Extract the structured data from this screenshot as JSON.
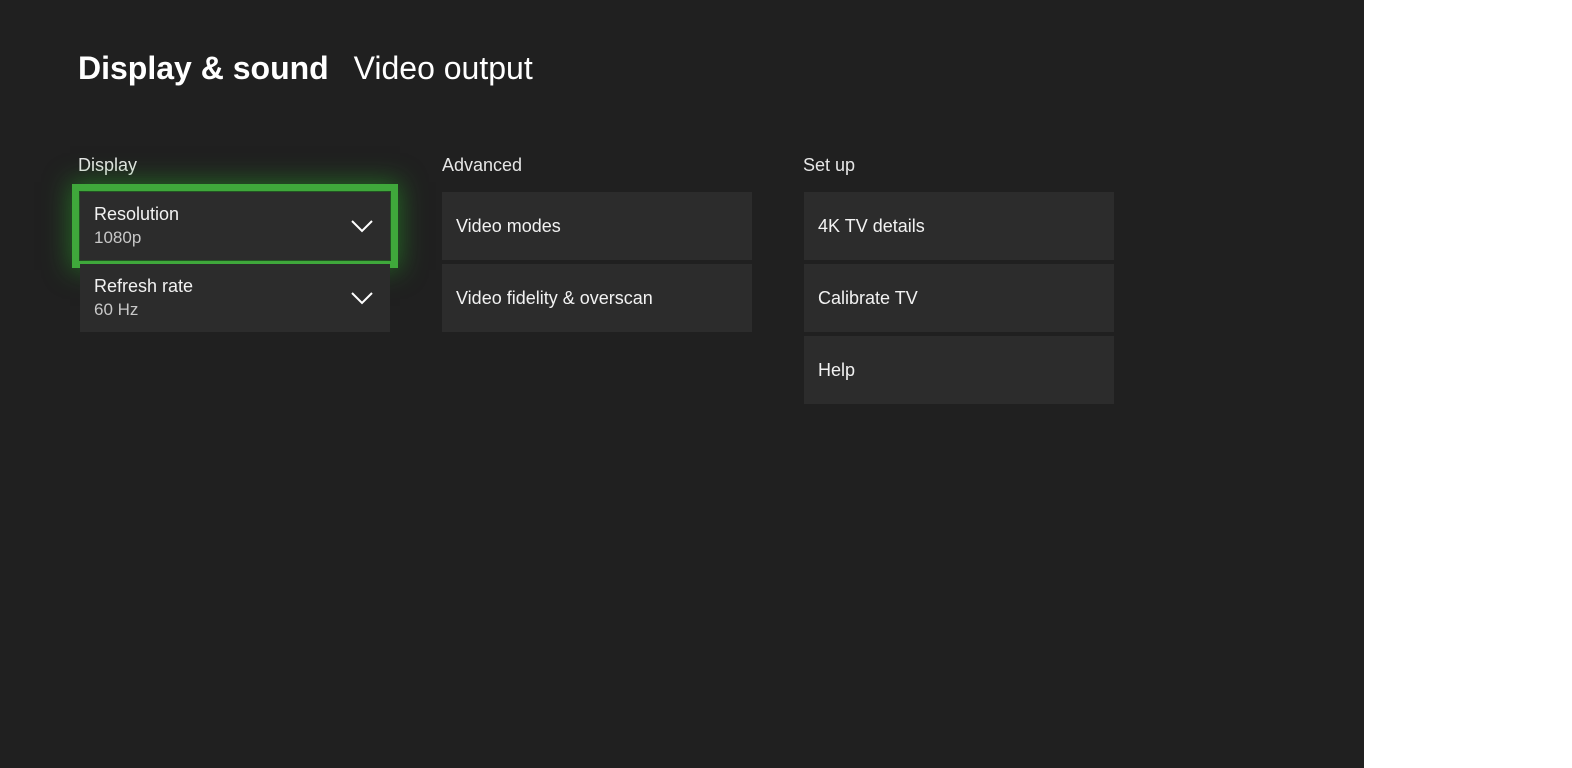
{
  "header": {
    "title": "Display & sound",
    "subtitle": "Video output"
  },
  "sections": {
    "display": {
      "label": "Display",
      "items": [
        {
          "label": "Resolution",
          "value": "1080p"
        },
        {
          "label": "Refresh rate",
          "value": "60 Hz"
        }
      ]
    },
    "advanced": {
      "label": "Advanced",
      "items": [
        {
          "label": "Video modes"
        },
        {
          "label": "Video fidelity & overscan"
        }
      ]
    },
    "setup": {
      "label": "Set up",
      "items": [
        {
          "label": "4K TV details"
        },
        {
          "label": "Calibrate TV"
        },
        {
          "label": "Help"
        }
      ]
    }
  },
  "focus": {
    "color": "#3fa83b",
    "item": "Resolution"
  },
  "icons": {
    "dropdown": "chevron-down-icon"
  }
}
